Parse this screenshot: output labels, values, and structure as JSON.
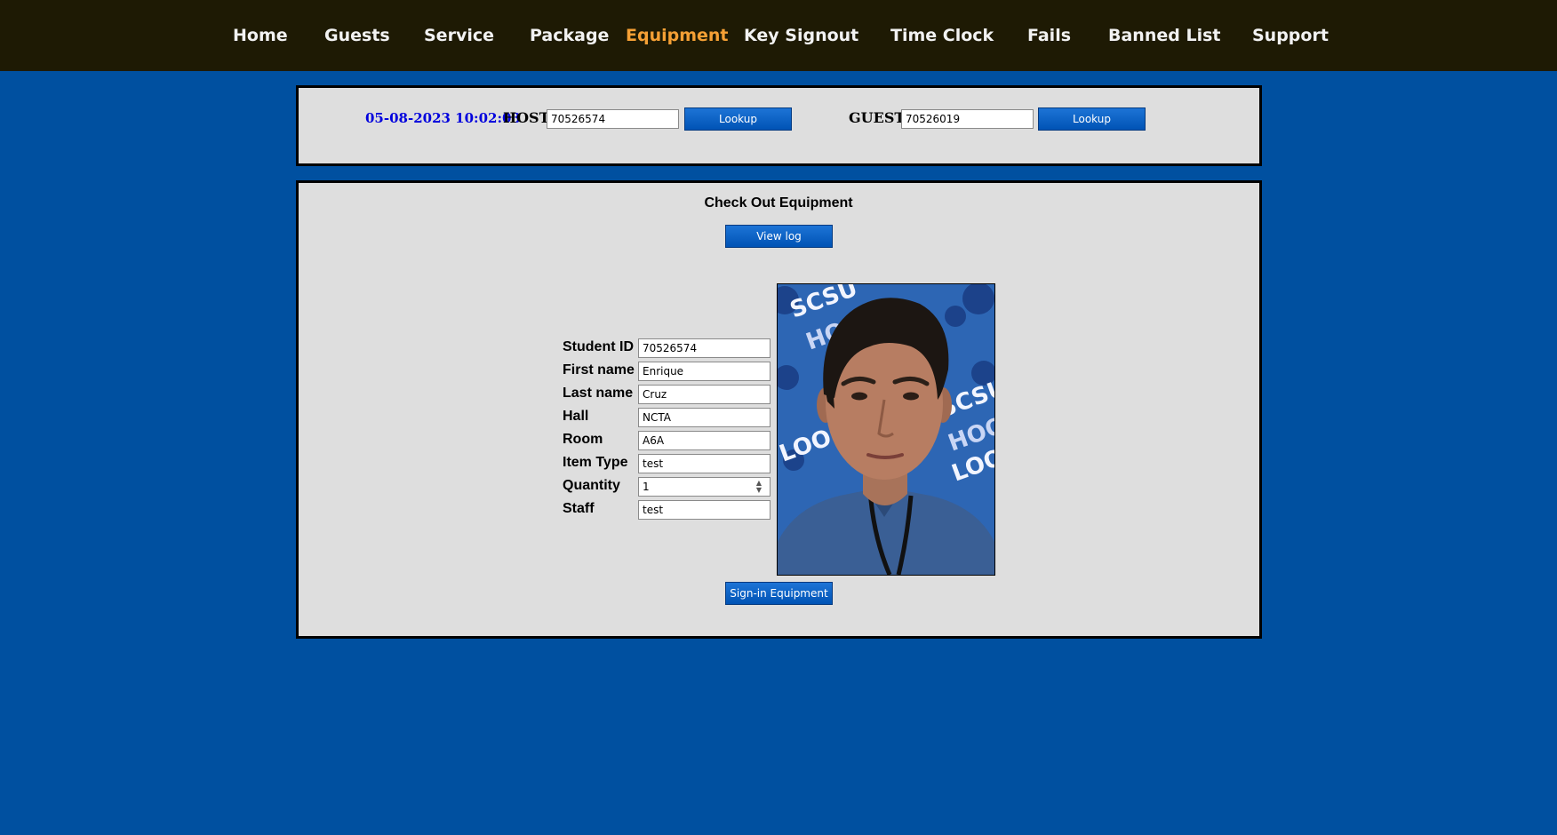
{
  "nav": {
    "items": [
      {
        "label": "Home"
      },
      {
        "label": "Guests"
      },
      {
        "label": "Service"
      },
      {
        "label": "Package"
      },
      {
        "label": "Equipment"
      },
      {
        "label": "Key Signout"
      },
      {
        "label": "Time Clock"
      },
      {
        "label": "Fails"
      },
      {
        "label": "Banned List"
      },
      {
        "label": "Support"
      }
    ],
    "active": "Equipment"
  },
  "lookup": {
    "datetime": "05-08-2023 10:02:03",
    "host_label": "HOST",
    "host_value": "70526574",
    "host_button": "Lookup",
    "guest_label": "GUEST",
    "guest_value": "70526019",
    "guest_button": "Lookup"
  },
  "checkout": {
    "title": "Check Out Equipment",
    "view_log_button": "View log",
    "submit_button": "Sign-in Equipment",
    "fields": [
      {
        "label": "Student ID",
        "value": "70526574"
      },
      {
        "label": "First name",
        "value": "Enrique"
      },
      {
        "label": "Last name",
        "value": "Cruz"
      },
      {
        "label": "Hall",
        "value": "NCTA"
      },
      {
        "label": "Room",
        "value": "A6A"
      },
      {
        "label": "Item Type",
        "value": "test"
      },
      {
        "label": "Quantity",
        "value": "1"
      },
      {
        "label": "Staff",
        "value": "test"
      }
    ],
    "photo_backdrop_text": [
      "SCSU",
      "HOO",
      "LOO",
      "SCSU",
      "HOO",
      "LOO"
    ]
  },
  "colors": {
    "page_background": "#0050a0",
    "nav_background": "#1e1a04",
    "nav_text": "#f2f2f2",
    "nav_active": "#f5a035",
    "panel_background": "#dedede",
    "datetime_text": "#0000dd",
    "button": "#0a62c4"
  }
}
